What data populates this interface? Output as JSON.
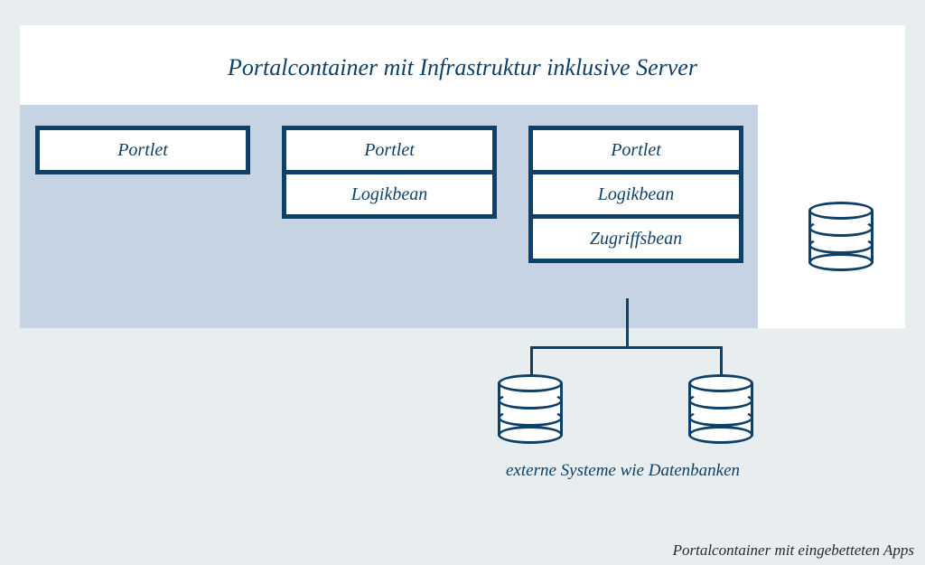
{
  "title": "Portalcontainer mit Infrastruktur inklusive Server",
  "stacks": {
    "s1": {
      "cells": [
        "Portlet"
      ]
    },
    "s2": {
      "cells": [
        "Portlet",
        "Logikbean"
      ]
    },
    "s3": {
      "cells": [
        "Portlet",
        "Logikbean",
        "Zugriffsbean"
      ]
    }
  },
  "external_caption": "externe Systeme wie Datenbanken",
  "figure_caption": "Portalcontainer mit eingebetteten Apps"
}
